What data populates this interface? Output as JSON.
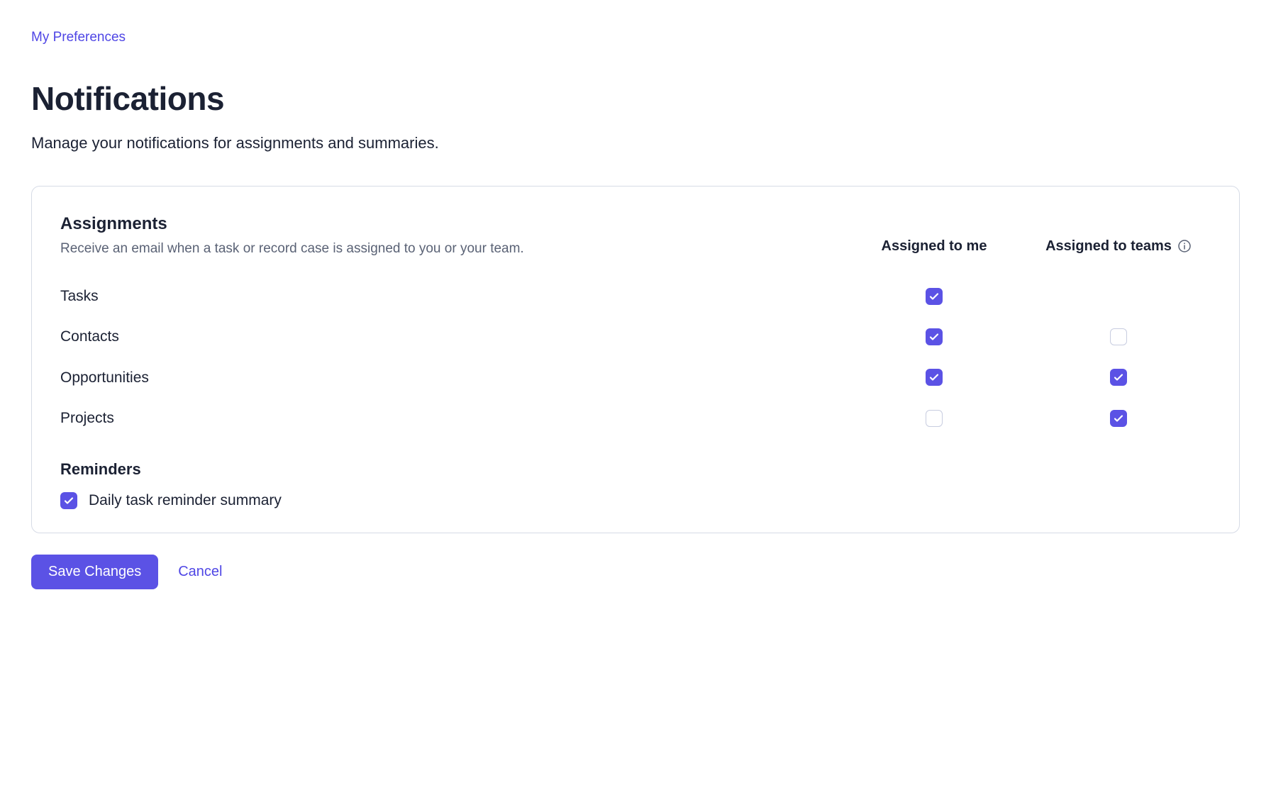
{
  "breadcrumb": {
    "label": "My Preferences"
  },
  "page": {
    "title": "Notifications",
    "subtitle": "Manage your notifications for assignments and summaries."
  },
  "assignments": {
    "title": "Assignments",
    "description": "Receive an email when a task or record case is assigned to you or your team.",
    "col_me": "Assigned to me",
    "col_teams": "Assigned to teams",
    "rows": [
      {
        "label": "Tasks",
        "me": true,
        "teams": null
      },
      {
        "label": "Contacts",
        "me": true,
        "teams": false
      },
      {
        "label": "Opportunities",
        "me": true,
        "teams": true
      },
      {
        "label": "Projects",
        "me": false,
        "teams": true
      }
    ]
  },
  "reminders": {
    "title": "Reminders",
    "daily_summary": {
      "label": "Daily task reminder summary",
      "checked": true
    }
  },
  "actions": {
    "save": "Save Changes",
    "cancel": "Cancel"
  },
  "colors": {
    "accent": "#5b52e5",
    "link": "#4f46e5",
    "text": "#1b2133",
    "muted": "#5a6275",
    "border": "#d6dbe6"
  }
}
